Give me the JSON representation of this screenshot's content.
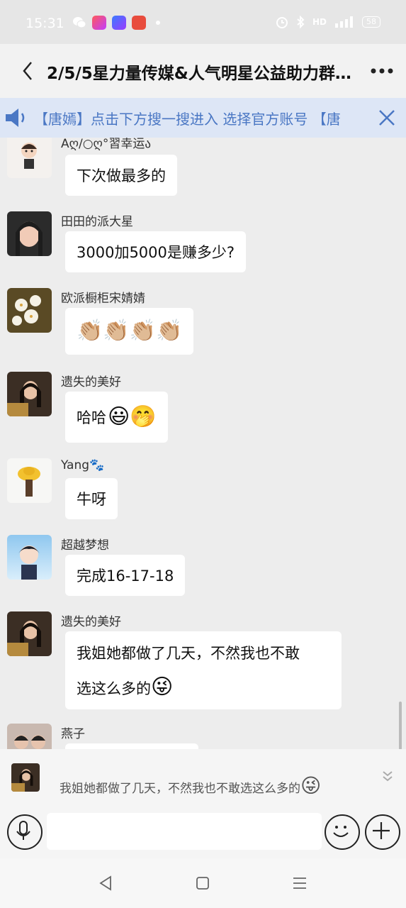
{
  "status_bar": {
    "time": "15:31",
    "battery": "58",
    "icons": [
      "wechat-icon",
      "app-icon-1",
      "app-icon-2",
      "app-icon-3",
      "alarm-icon",
      "bluetooth-icon",
      "hd-icon",
      "signal-icon",
      "battery-icon"
    ]
  },
  "header": {
    "title": "2/5/5星力量传媒&人气明星公益助力群…",
    "back_icon": "chevron-left-icon",
    "more_icon": "more-dots-icon"
  },
  "notice": {
    "text": "【唐嫣】点击下方搜一搜进入 选择官方账号 【唐",
    "icon": "speaker-icon",
    "close_icon": "close-icon"
  },
  "messages": [
    {
      "sender": "Aღ/○ღ°習幸运ა",
      "text": "下次做最多的",
      "emoji": ""
    },
    {
      "sender": "田田的派大星",
      "text": "3000加5000是赚多少?",
      "emoji": ""
    },
    {
      "sender": "欧派橱柜宋婧婧",
      "text": "",
      "emoji": "👏🏼👏🏼👏🏼👏🏼"
    },
    {
      "sender": "遗失的美好",
      "text": "哈哈",
      "emoji": "😃🤭"
    },
    {
      "sender": "Yang🐾",
      "text": "牛呀",
      "emoji": ""
    },
    {
      "sender": "超越梦想",
      "text": "完成16-17-18",
      "emoji": ""
    },
    {
      "sender": "遗失的美好",
      "text_line1": "我姐她都做了几天，不然我也不敢",
      "text_line2": "选这么多的",
      "emoji": "😜"
    },
    {
      "sender": "燕子",
      "text": "",
      "emoji": ""
    }
  ],
  "quote": {
    "text": "我姐她都做了几天，不然我也不敢选这么多的",
    "emoji": "😜",
    "chevron_icon": "double-chevron-down-icon"
  },
  "input_bar": {
    "voice_icon": "microphone-icon",
    "emoji_icon": "smiley-icon",
    "plus_icon": "plus-icon",
    "placeholder": ""
  },
  "nav_bar": {
    "icons": [
      "nav-back-icon",
      "nav-home-icon",
      "nav-menu-icon"
    ]
  },
  "colors": {
    "background": "#ededed",
    "notice_bg": "#dde6f6",
    "notice_text": "#4a77c4",
    "bubble": "#ffffff"
  }
}
